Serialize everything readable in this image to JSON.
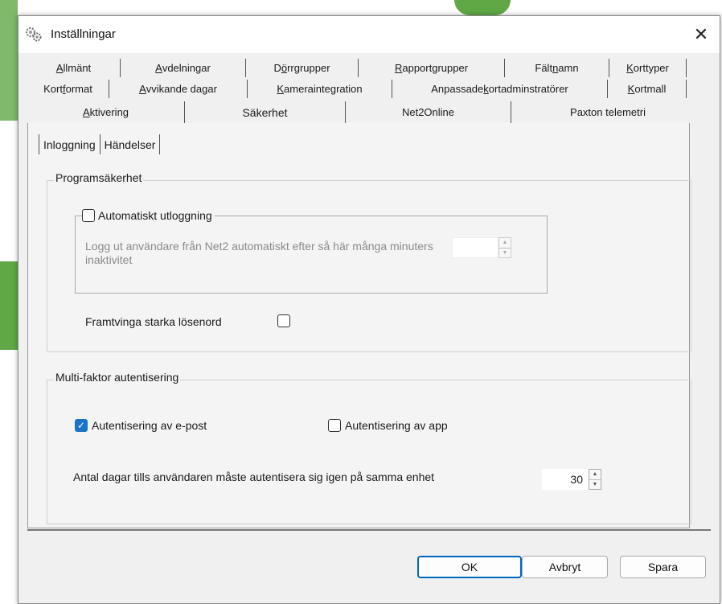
{
  "dialog": {
    "title": "Inställningar",
    "title_icon": "gears-icon",
    "close_glyph": "✕"
  },
  "tabs": {
    "row1": [
      {
        "label": "Allmänt",
        "u": "A",
        "rest": "llmänt"
      },
      {
        "label": "Avdelningar",
        "u": "A",
        "rest": "vdelningar"
      },
      {
        "label": "Dörrgrupper",
        "pre": "D",
        "u": "ö",
        "rest": "rrgrupper"
      },
      {
        "label": "Rapportgrupper",
        "u": "R",
        "rest": "apportgrupper"
      },
      {
        "label": "Fältnamn",
        "pre": "Fält",
        "u": "n",
        "rest": "amn"
      },
      {
        "label": "Korttyper",
        "u": "K",
        "rest": "orttyper"
      }
    ],
    "row2": [
      {
        "label": "Kortformat",
        "pre": "Kort",
        "u": "f",
        "rest": "ormat"
      },
      {
        "label": "Avvikande dagar",
        "u": "A",
        "rest": "vvikande dagar"
      },
      {
        "label": "Kameraintegration",
        "u": "K",
        "rest": "ameraintegration"
      },
      {
        "label": "Anpassade kortadminstratörer",
        "pre": "Anpassade ",
        "u": "k",
        "rest": "ortadminstratörer"
      },
      {
        "label": "Kortmall",
        "u": "K",
        "rest": "ortmall"
      }
    ],
    "row3": [
      {
        "label": "Aktivering",
        "u": "A",
        "rest": "ktivering"
      },
      {
        "label": "Säkerhet",
        "active": true
      },
      {
        "label": "Net2Online"
      },
      {
        "label": "Paxton telemetri"
      }
    ]
  },
  "inner_tabs": [
    "Inloggning",
    "Händelser"
  ],
  "program_security": {
    "group_label": "Programsäkerhet",
    "auto_logout": {
      "label": "Automatiskt utloggning",
      "checked": false,
      "description": "Logg ut användare från Net2 automatiskt efter så här många minuters inaktivitet",
      "value": ""
    },
    "strong_passwords": {
      "label": "Framtvinga starka lösenord",
      "checked": false
    }
  },
  "mfa": {
    "group_label": "Multi-faktor autentisering",
    "email": {
      "label": "Autentisering av e-post",
      "checked": true
    },
    "app": {
      "label": "Autentisering av app",
      "checked": false
    },
    "days": {
      "label": "Antal dagar tills användaren måste autentisera sig igen på samma enhet",
      "value": "30"
    }
  },
  "buttons": {
    "ok": "OK",
    "cancel": "Avbryt",
    "save": "Spara"
  },
  "colors": {
    "accent": "#0067c0",
    "checkbox_checked": "#1a73c9",
    "background_app_green": "#6aa84f"
  }
}
